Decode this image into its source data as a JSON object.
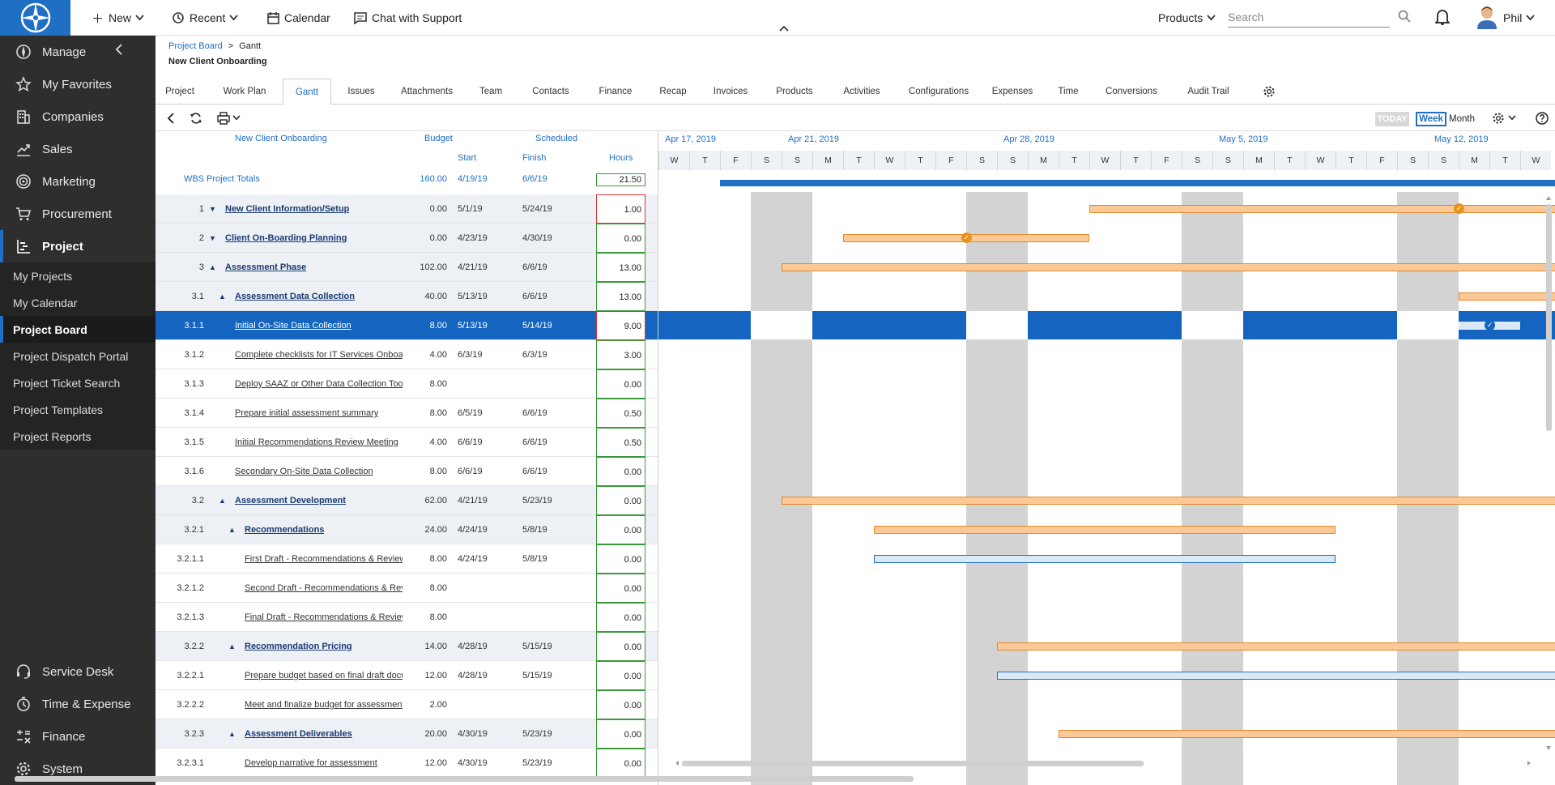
{
  "topbar": {
    "new_label": "New",
    "recent_label": "Recent",
    "calendar_label": "Calendar",
    "chat_label": "Chat with Support",
    "products_label": "Products",
    "search_placeholder": "Search",
    "user_name": "Phil"
  },
  "sidebar": {
    "items": [
      {
        "label": "Manage",
        "icon": "compass-icon"
      },
      {
        "label": "My Favorites",
        "icon": "star-icon"
      },
      {
        "label": "Companies",
        "icon": "building-icon"
      },
      {
        "label": "Sales",
        "icon": "chart-icon"
      },
      {
        "label": "Marketing",
        "icon": "target-icon"
      },
      {
        "label": "Procurement",
        "icon": "cart-icon"
      },
      {
        "label": "Project",
        "icon": "project-icon"
      }
    ],
    "sub_items": [
      "My Projects",
      "My Calendar",
      "Project Board",
      "Project Dispatch Portal",
      "Project Ticket Search",
      "Project Templates",
      "Project Reports"
    ],
    "bottom_items": [
      {
        "label": "Service Desk",
        "icon": "headset-icon"
      },
      {
        "label": "Time & Expense",
        "icon": "clock-icon"
      },
      {
        "label": "Finance",
        "icon": "finance-icon"
      },
      {
        "label": "System",
        "icon": "gear-icon"
      }
    ]
  },
  "breadcrumb": {
    "parent": "Project Board",
    "sep": ">",
    "current": "Gantt"
  },
  "page_title": "New Client Onboarding",
  "tabs": [
    "Project",
    "Work Plan",
    "Gantt",
    "Issues",
    "Attachments",
    "Team",
    "Contacts",
    "Finance",
    "Recap",
    "Invoices",
    "Products",
    "Activities",
    "Configurations",
    "Expenses",
    "Time",
    "Conversions",
    "Audit Trail"
  ],
  "toolbar": {
    "today": "TODAY",
    "week": "Week",
    "month": "Month"
  },
  "grid": {
    "header_project": "New Client Onboarding",
    "header_budget": "Budget",
    "header_scheduled": "Scheduled",
    "header_start": "Start",
    "header_finish": "Finish",
    "header_hours": "Hours",
    "totals": {
      "wbs": "WBS",
      "name": "Project Totals",
      "budget": "160.00",
      "start": "4/19/19",
      "finish": "6/6/19",
      "hours": "21.50"
    },
    "rows": [
      {
        "wbs": "1",
        "name": "New Client Information/Setup",
        "budget": "0.00",
        "start": "5/1/19",
        "finish": "5/24/19",
        "hours": "1.00"
      },
      {
        "wbs": "2",
        "name": "Client On-Boarding Planning",
        "budget": "0.00",
        "start": "4/23/19",
        "finish": "4/30/19",
        "hours": "0.00"
      },
      {
        "wbs": "3",
        "name": "Assessment Phase",
        "budget": "102.00",
        "start": "4/21/19",
        "finish": "6/6/19",
        "hours": "13.00"
      },
      {
        "wbs": "3.1",
        "name": "Assessment Data Collection",
        "budget": "40.00",
        "start": "5/13/19",
        "finish": "6/6/19",
        "hours": "13.00"
      },
      {
        "wbs": "3.1.1",
        "name": "Initial On-Site Data Collection",
        "budget": "8.00",
        "start": "5/13/19",
        "finish": "5/14/19",
        "hours": "9.00"
      },
      {
        "wbs": "3.1.2",
        "name": "Complete checklists for IT Services Onboard",
        "budget": "4.00",
        "start": "6/3/19",
        "finish": "6/3/19",
        "hours": "3.00"
      },
      {
        "wbs": "3.1.3",
        "name": "Deploy SAAZ or Other Data Collection Tools",
        "budget": "8.00",
        "start": "",
        "finish": "",
        "hours": "0.00"
      },
      {
        "wbs": "3.1.4",
        "name": "Prepare initial assessment summary",
        "budget": "8.00",
        "start": "6/5/19",
        "finish": "6/6/19",
        "hours": "0.50"
      },
      {
        "wbs": "3.1.5",
        "name": "Initial Recommendations Review Meeting",
        "budget": "4.00",
        "start": "6/6/19",
        "finish": "6/6/19",
        "hours": "0.50"
      },
      {
        "wbs": "3.1.6",
        "name": "Secondary On-Site Data Collection",
        "budget": "8.00",
        "start": "6/6/19",
        "finish": "6/6/19",
        "hours": "0.00"
      },
      {
        "wbs": "3.2",
        "name": "Assessment Development",
        "budget": "62.00",
        "start": "4/21/19",
        "finish": "5/23/19",
        "hours": "0.00"
      },
      {
        "wbs": "3.2.1",
        "name": "Recommendations",
        "budget": "24.00",
        "start": "4/24/19",
        "finish": "5/8/19",
        "hours": "0.00"
      },
      {
        "wbs": "3.2.1.1",
        "name": "First Draft - Recommendations & Review",
        "budget": "8.00",
        "start": "4/24/19",
        "finish": "5/8/19",
        "hours": "0.00"
      },
      {
        "wbs": "3.2.1.2",
        "name": "Second Draft - Recommendations & Revie",
        "budget": "8.00",
        "start": "",
        "finish": "",
        "hours": "0.00"
      },
      {
        "wbs": "3.2.1.3",
        "name": "Final Draft - Recommendations & Review",
        "budget": "8.00",
        "start": "",
        "finish": "",
        "hours": "0.00"
      },
      {
        "wbs": "3.2.2",
        "name": "Recommendation Pricing",
        "budget": "14.00",
        "start": "4/28/19",
        "finish": "5/15/19",
        "hours": "0.00"
      },
      {
        "wbs": "3.2.2.1",
        "name": "Prepare budget based on final draft docur",
        "budget": "12.00",
        "start": "4/28/19",
        "finish": "5/15/19",
        "hours": "0.00"
      },
      {
        "wbs": "3.2.2.2",
        "name": "Meet and finalize budget for assessment.",
        "budget": "2.00",
        "start": "",
        "finish": "",
        "hours": "0.00"
      },
      {
        "wbs": "3.2.3",
        "name": "Assessment Deliverables",
        "budget": "20.00",
        "start": "4/30/19",
        "finish": "5/23/19",
        "hours": "0.00"
      },
      {
        "wbs": "3.2.3.1",
        "name": "Develop narrative for assessment",
        "budget": "12.00",
        "start": "4/30/19",
        "finish": "5/23/19",
        "hours": "0.00"
      }
    ]
  },
  "gantt": {
    "weeks": [
      "Apr 17, 2019",
      "Apr 21, 2019",
      "Apr 28, 2019",
      "May 5, 2019",
      "May 12, 2019"
    ],
    "days": [
      "W",
      "T",
      "F",
      "S",
      "S",
      "M",
      "T",
      "W",
      "T",
      "F",
      "S",
      "S",
      "M",
      "T",
      "W",
      "T",
      "F",
      "S",
      "S",
      "M",
      "T",
      "W",
      "T",
      "F",
      "S",
      "S",
      "M",
      "T",
      "W"
    ],
    "bars": [
      {
        "row": 0,
        "start": "2019-05-01",
        "end": "2019-05-31",
        "kind": "summary",
        "milestone": "2019-05-13"
      },
      {
        "row": 1,
        "start": "2019-04-23",
        "end": "2019-05-01",
        "kind": "summary",
        "milestone": "2019-04-27"
      },
      {
        "row": 2,
        "start": "2019-04-21",
        "end": "2019-05-31",
        "kind": "summary"
      },
      {
        "row": 3,
        "start": "2019-05-13",
        "end": "2019-05-31",
        "kind": "summary"
      },
      {
        "row": 4,
        "start": "2019-05-13",
        "end": "2019-05-15",
        "kind": "selected",
        "milestone": "2019-05-14"
      },
      {
        "row": 10,
        "start": "2019-04-21",
        "end": "2019-05-31",
        "kind": "summary"
      },
      {
        "row": 11,
        "start": "2019-04-24",
        "end": "2019-05-09",
        "kind": "summary"
      },
      {
        "row": 12,
        "start": "2019-04-24",
        "end": "2019-05-09",
        "kind": "task"
      },
      {
        "row": 15,
        "start": "2019-04-28",
        "end": "2019-05-31",
        "kind": "summary"
      },
      {
        "row": 16,
        "start": "2019-04-28",
        "end": "2019-05-31",
        "kind": "task"
      },
      {
        "row": 18,
        "start": "2019-04-30",
        "end": "2019-05-31",
        "kind": "summary"
      }
    ]
  }
}
